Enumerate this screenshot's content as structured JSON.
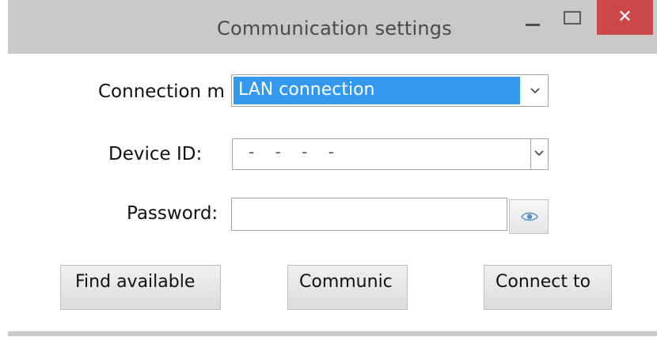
{
  "window": {
    "title": "Communication settings",
    "close_glyph": "✕"
  },
  "form": {
    "connection_mode_label": "Connection m",
    "connection_mode_value": "LAN connection",
    "device_id_label": "Device ID:",
    "device_id_value": "- - - -",
    "password_label": "Password:",
    "password_value": ""
  },
  "buttons": {
    "find_available": "Find available",
    "communicate": "Communic",
    "connect_to": "Connect to"
  },
  "icons": {
    "chevron": "chevron-down-icon",
    "eye": "eye-icon"
  },
  "colors": {
    "titlebar": "#c9c9c9",
    "close_button": "#cb4949",
    "selection": "#3399ee"
  }
}
